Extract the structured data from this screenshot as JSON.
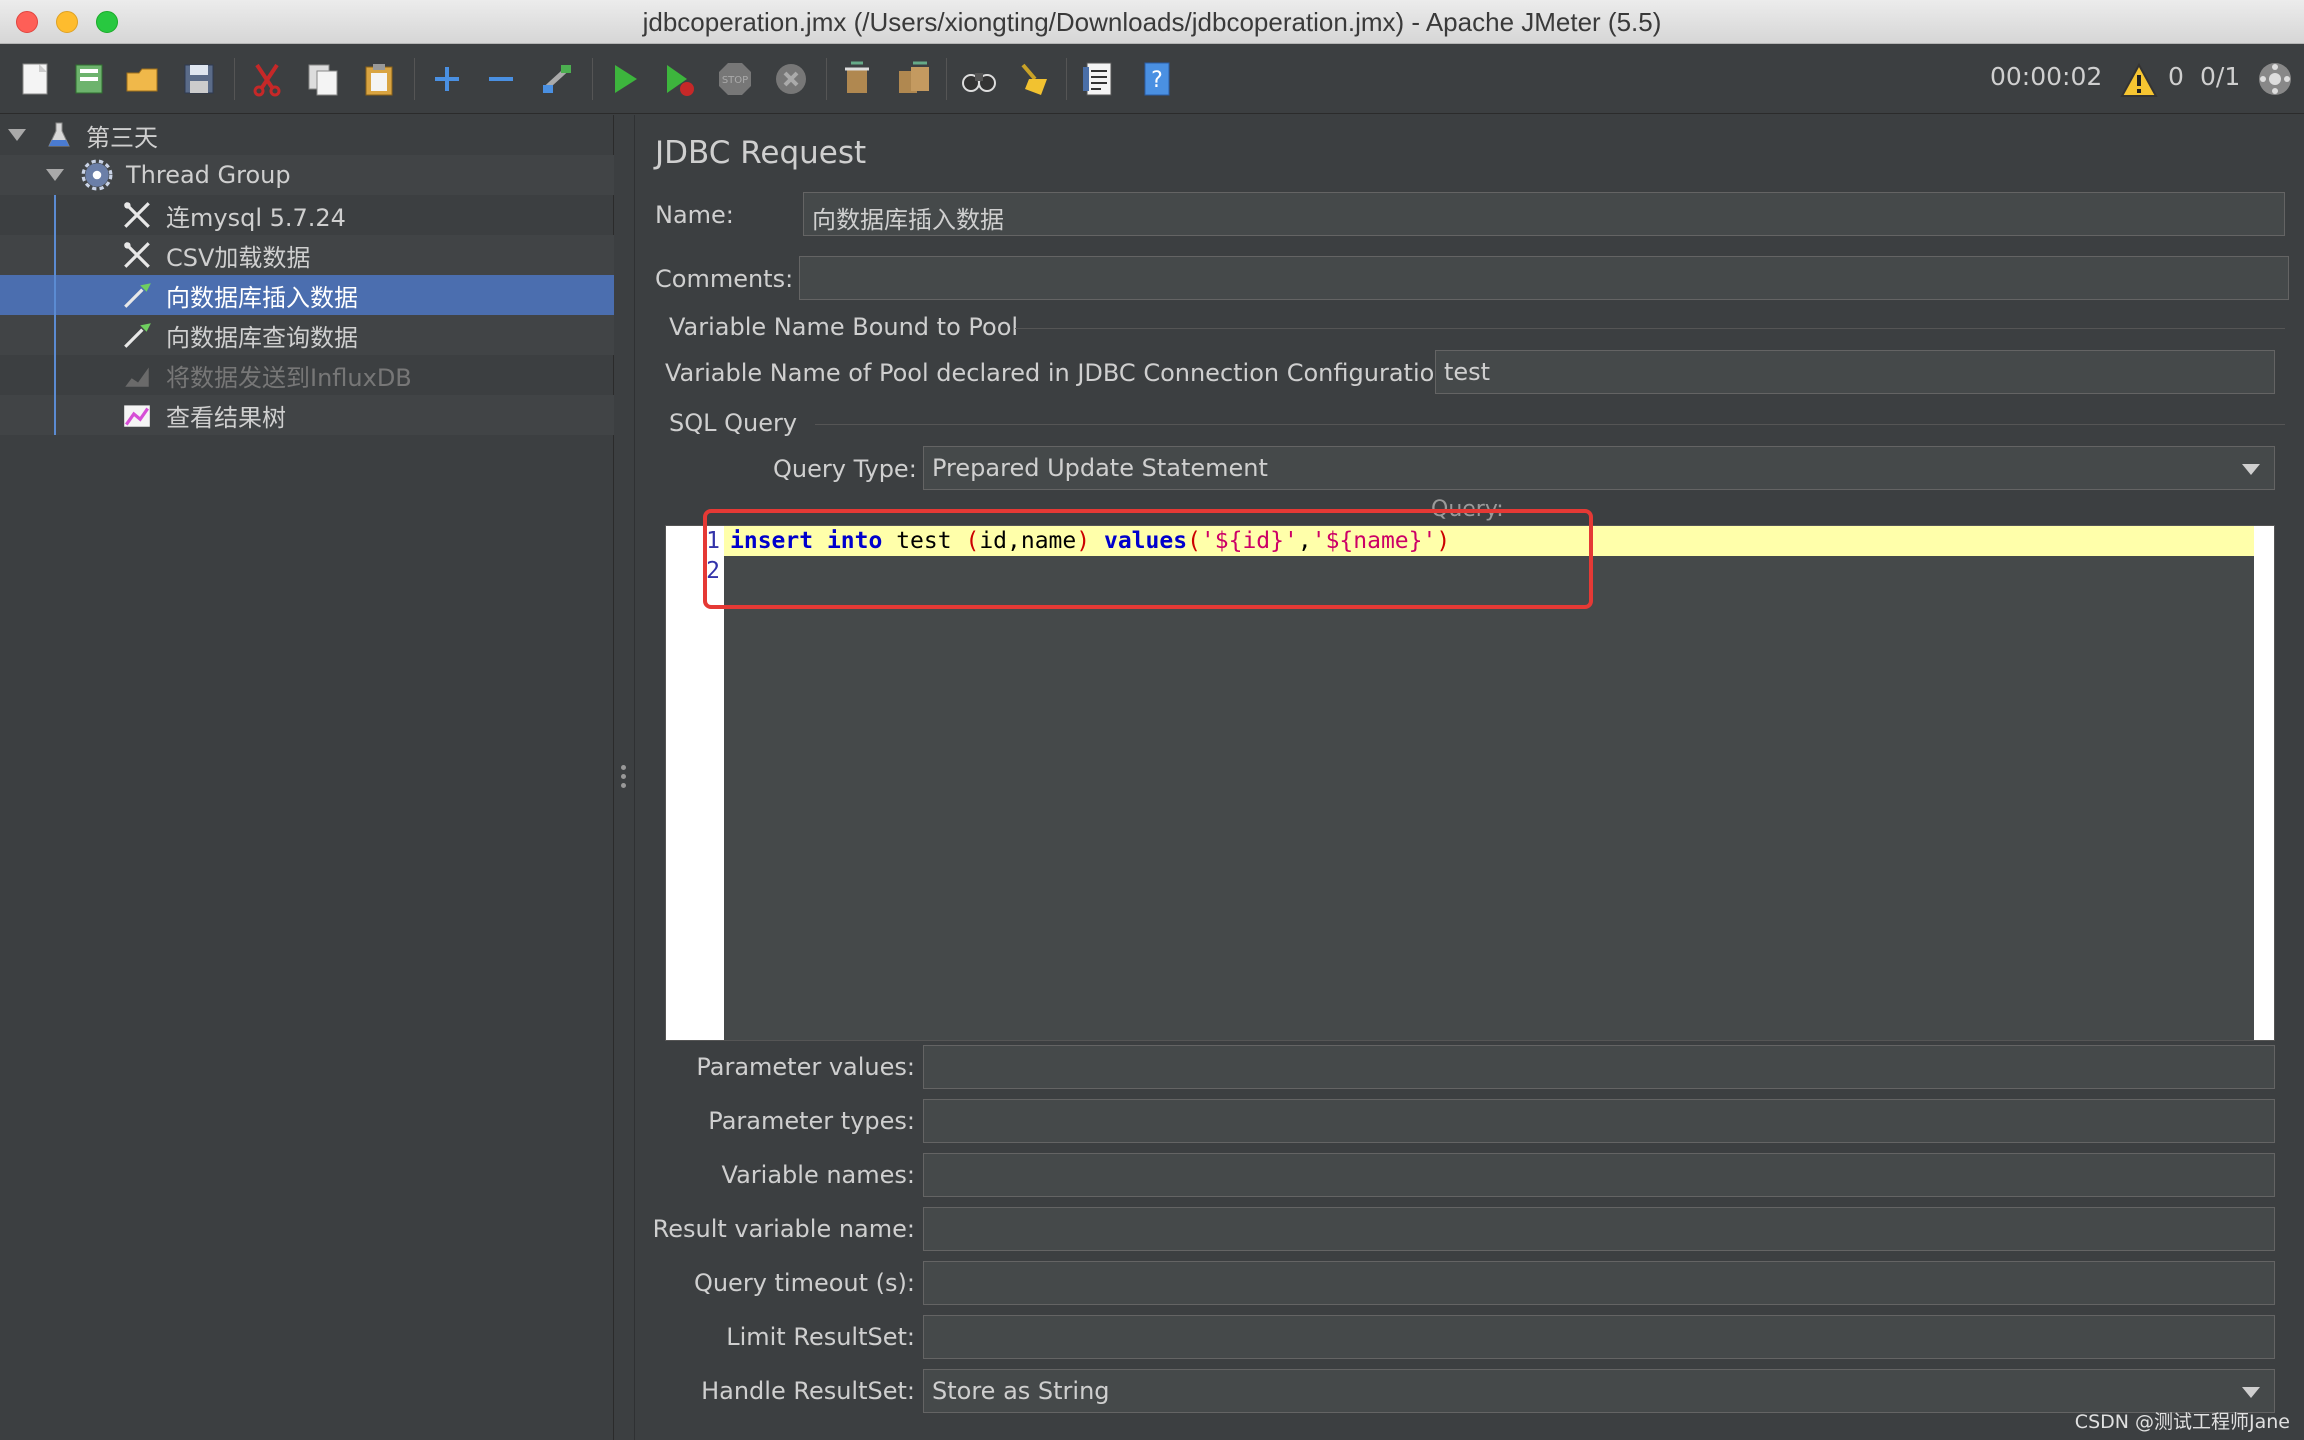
{
  "window": {
    "title": "jdbcoperation.jmx (/Users/xiongting/Downloads/jdbcoperation.jmx) - Apache JMeter (5.5)"
  },
  "toolbar": {
    "timer": "00:00:02",
    "warning_count": "0",
    "thread_status": "0/1",
    "buttons": [
      "new-icon",
      "templates-icon",
      "open-icon",
      "save-icon",
      "cut-icon",
      "copy-icon",
      "paste-icon",
      "expand-icon",
      "collapse-icon",
      "toggle-icon",
      "start-icon",
      "start-no-pause-icon",
      "stop-icon",
      "shutdown-icon",
      "clear-icon",
      "clear-all-icon",
      "search-icon",
      "reset-search-icon",
      "function-helper-icon",
      "help-icon"
    ]
  },
  "tree": {
    "items": [
      {
        "label": "第三天",
        "icon": "flask-icon"
      },
      {
        "label": "Thread Group",
        "icon": "gear-icon"
      },
      {
        "label": "连mysql 5.7.24",
        "icon": "config-icon"
      },
      {
        "label": "CSV加载数据",
        "icon": "config-icon"
      },
      {
        "label": "向数据库插入数据",
        "icon": "sampler-icon"
      },
      {
        "label": "向数据库查询数据",
        "icon": "sampler-icon"
      },
      {
        "label": "将数据发送到InfluxDB",
        "icon": "listener-icon"
      },
      {
        "label": "查看结果树",
        "icon": "listener-icon"
      }
    ]
  },
  "panel": {
    "title": "JDBC Request",
    "name_label": "Name:",
    "name_value": "向数据库插入数据",
    "comments_label": "Comments:",
    "comments_value": "",
    "pool_group_title": "Variable Name Bound to Pool",
    "pool_label": "Variable Name of Pool declared in JDBC Connection Configuration:",
    "pool_value": "test",
    "sql_group_title": "SQL Query",
    "query_type_label": "Query Type:",
    "query_type_value": "Prepared Update Statement",
    "query_label": "Query:",
    "line_numbers": [
      "1",
      "2"
    ],
    "code": {
      "insert": "insert",
      "into": "into",
      "table": "test",
      "open": "(",
      "cols": "id,name",
      "close": ")",
      "values": "values",
      "vopen": "(",
      "v1": "'${id}'",
      "comma": ",",
      "v2": "'${name}'",
      "vclose": ")"
    },
    "param_values_label": "Parameter values:",
    "param_types_label": "Parameter types:",
    "variable_names_label": "Variable names:",
    "result_variable_label": "Result variable name:",
    "query_timeout_label": "Query timeout (s):",
    "limit_resultset_label": "Limit ResultSet:",
    "handle_resultset_label": "Handle ResultSet:",
    "handle_resultset_value": "Store as String"
  },
  "watermark": "CSDN @测试工程师Jane",
  "colors": {
    "background": "#3c3f41",
    "selection": "#4b6eaf",
    "highlight_box": "#e53935"
  }
}
